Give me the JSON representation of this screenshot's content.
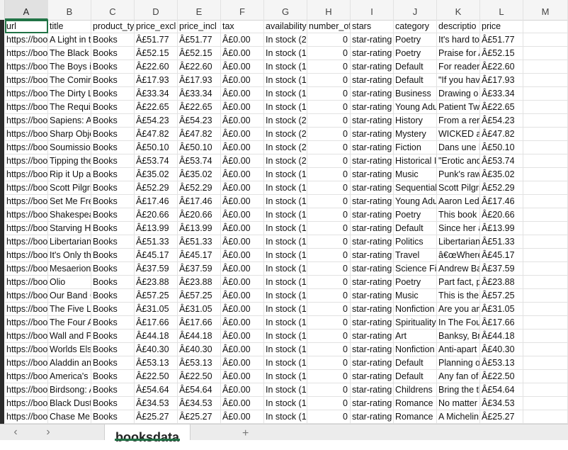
{
  "sheet": {
    "active_tab": "booksdata",
    "column_letters": [
      "A",
      "B",
      "C",
      "D",
      "E",
      "F",
      "G",
      "H",
      "I",
      "J",
      "K",
      "L",
      "M"
    ],
    "headers": [
      "url",
      "title",
      "product_ty",
      "price_excl",
      "price_incl",
      "tax",
      "availability",
      "number_of",
      "stars",
      "category",
      "descriptio",
      "price",
      ""
    ],
    "rows": [
      [
        "https://boo",
        "A Light in tl",
        "Books",
        "Â£51.77",
        "Â£51.77",
        "Â£0.00",
        "In stock (2",
        "0",
        "star-rating",
        "Poetry",
        "It's hard to",
        "Â£51.77"
      ],
      [
        "https://boo",
        "The Black",
        "Books",
        "Â£52.15",
        "Â£52.15",
        "Â£0.00",
        "In stock (1",
        "0",
        "star-rating",
        "Poetry",
        "Praise for A",
        "Â£52.15"
      ],
      [
        "https://boo",
        "The Boys ii",
        "Books",
        "Â£22.60",
        "Â£22.60",
        "Â£0.00",
        "In stock (1",
        "0",
        "star-rating",
        "Default",
        "For reader",
        "Â£22.60"
      ],
      [
        "https://boo",
        "The Comir",
        "Books",
        "Â£17.93",
        "Â£17.93",
        "Â£0.00",
        "In stock (1",
        "0",
        "star-rating",
        "Default",
        "\"If you hav",
        "Â£17.93"
      ],
      [
        "https://boo",
        "The Dirty L",
        "Books",
        "Â£33.34",
        "Â£33.34",
        "Â£0.00",
        "In stock (1",
        "0",
        "star-rating",
        "Business",
        "Drawing o",
        "Â£33.34"
      ],
      [
        "https://boo",
        "The Requi",
        "Books",
        "Â£22.65",
        "Â£22.65",
        "Â£0.00",
        "In stock (1",
        "0",
        "star-rating",
        "Young Adu",
        "Patient Tw",
        "Â£22.65"
      ],
      [
        "https://boo",
        "Sapiens: A",
        "Books",
        "Â£54.23",
        "Â£54.23",
        "Â£0.00",
        "In stock (2",
        "0",
        "star-rating",
        "History",
        "From a rer",
        "Â£54.23"
      ],
      [
        "https://boo",
        "Sharp Obje",
        "Books",
        "Â£47.82",
        "Â£47.82",
        "Â£0.00",
        "In stock (2",
        "0",
        "star-rating",
        "Mystery",
        "WICKED al",
        "Â£47.82"
      ],
      [
        "https://boo",
        "Soumissio",
        "Books",
        "Â£50.10",
        "Â£50.10",
        "Â£0.00",
        "In stock (2",
        "0",
        "star-rating",
        "Fiction",
        "Dans une l",
        "Â£50.10"
      ],
      [
        "https://boo",
        "Tipping the",
        "Books",
        "Â£53.74",
        "Â£53.74",
        "Â£0.00",
        "In stock (2",
        "0",
        "star-rating",
        "Historical I",
        "\"Erotic and",
        "Â£53.74"
      ],
      [
        "https://boo",
        "Rip it Up a",
        "Books",
        "Â£35.02",
        "Â£35.02",
        "Â£0.00",
        "In stock (1",
        "0",
        "star-rating",
        "Music",
        "Punk's raw",
        "Â£35.02"
      ],
      [
        "https://boo",
        "Scott Pilgri",
        "Books",
        "Â£52.29",
        "Â£52.29",
        "Â£0.00",
        "In stock (1",
        "0",
        "star-rating",
        "Sequential",
        "Scott Pilgri",
        "Â£52.29"
      ],
      [
        "https://boo",
        "Set Me Fre",
        "Books",
        "Â£17.46",
        "Â£17.46",
        "Â£0.00",
        "In stock (1",
        "0",
        "star-rating",
        "Young Adu",
        "Aaron Ledl",
        "Â£17.46"
      ],
      [
        "https://boo",
        "Shakespea",
        "Books",
        "Â£20.66",
        "Â£20.66",
        "Â£0.00",
        "In stock (1",
        "0",
        "star-rating",
        "Poetry",
        "This book i",
        "Â£20.66"
      ],
      [
        "https://boo",
        "Starving He",
        "Books",
        "Â£13.99",
        "Â£13.99",
        "Â£0.00",
        "In stock (1",
        "0",
        "star-rating",
        "Default",
        "Since her a",
        "Â£13.99"
      ],
      [
        "https://boo",
        "Libertarian",
        "Books",
        "Â£51.33",
        "Â£51.33",
        "Â£0.00",
        "In stock (1",
        "0",
        "star-rating",
        "Politics",
        "Libertarian",
        "Â£51.33"
      ],
      [
        "https://boo",
        "It's Only th",
        "Books",
        "Â£45.17",
        "Â£45.17",
        "Â£0.00",
        "In stock (1",
        "0",
        "star-rating",
        "Travel",
        "â€œWhere",
        "Â£45.17"
      ],
      [
        "https://boo",
        "Mesaerion",
        "Books",
        "Â£37.59",
        "Â£37.59",
        "Â£0.00",
        "In stock (1",
        "0",
        "star-rating",
        "Science Fi",
        "Andrew Ba",
        "Â£37.59"
      ],
      [
        "https://boo",
        "Olio",
        "Books",
        "Â£23.88",
        "Â£23.88",
        "Â£0.00",
        "In stock (1",
        "0",
        "star-rating",
        "Poetry",
        "Part fact, p",
        "Â£23.88"
      ],
      [
        "https://boo",
        "Our Band C",
        "Books",
        "Â£57.25",
        "Â£57.25",
        "Â£0.00",
        "In stock (1",
        "0",
        "star-rating",
        "Music",
        "This is the",
        "Â£57.25"
      ],
      [
        "https://boo",
        "The Five Lo",
        "Books",
        "Â£31.05",
        "Â£31.05",
        "Â£0.00",
        "In stock (1",
        "0",
        "star-rating",
        "Nonfiction",
        "Are you an",
        "Â£31.05"
      ],
      [
        "https://boo",
        "The Four A",
        "Books",
        "Â£17.66",
        "Â£17.66",
        "Â£0.00",
        "In stock (1",
        "0",
        "star-rating",
        "Spirituality",
        "In The Fou",
        "Â£17.66"
      ],
      [
        "https://boo",
        "Wall and P",
        "Books",
        "Â£44.18",
        "Â£44.18",
        "Â£0.00",
        "In stock (1",
        "0",
        "star-rating",
        "Art",
        "Banksy, Br",
        "Â£44.18"
      ],
      [
        "https://boo",
        "Worlds Els",
        "Books",
        "Â£40.30",
        "Â£40.30",
        "Â£0.00",
        "In stock (1",
        "0",
        "star-rating",
        "Nonfiction",
        "Anti-apart",
        "Â£40.30"
      ],
      [
        "https://boo",
        "Aladdin an",
        "Books",
        "Â£53.13",
        "Â£53.13",
        "Â£0.00",
        "In stock (1",
        "0",
        "star-rating",
        "Default",
        "Planning o",
        "Â£53.13"
      ],
      [
        "https://boo",
        "America's",
        "Books",
        "Â£22.50",
        "Â£22.50",
        "Â£0.00",
        "In stock (1",
        "0",
        "star-rating",
        "Default",
        "Any fan of",
        "Â£22.50"
      ],
      [
        "https://boo",
        "Birdsong: A",
        "Books",
        "Â£54.64",
        "Â£54.64",
        "Â£0.00",
        "In stock (1",
        "0",
        "star-rating",
        "Childrens",
        "Bring the tl",
        "Â£54.64"
      ],
      [
        "https://boo",
        "Black Dust",
        "Books",
        "Â£34.53",
        "Â£34.53",
        "Â£0.00",
        "In stock (1",
        "0",
        "star-rating",
        "Romance",
        "No matter",
        "Â£34.53"
      ],
      [
        "https://boo",
        "Chase Me",
        "Books",
        "Â£25.27",
        "Â£25.27",
        "Â£0.00",
        "In stock (1",
        "0",
        "star-rating",
        "Romance",
        "A Michelin",
        "Â£25.27"
      ]
    ]
  },
  "tabbar": {
    "prev": "‹",
    "next": "›",
    "add": "+"
  }
}
